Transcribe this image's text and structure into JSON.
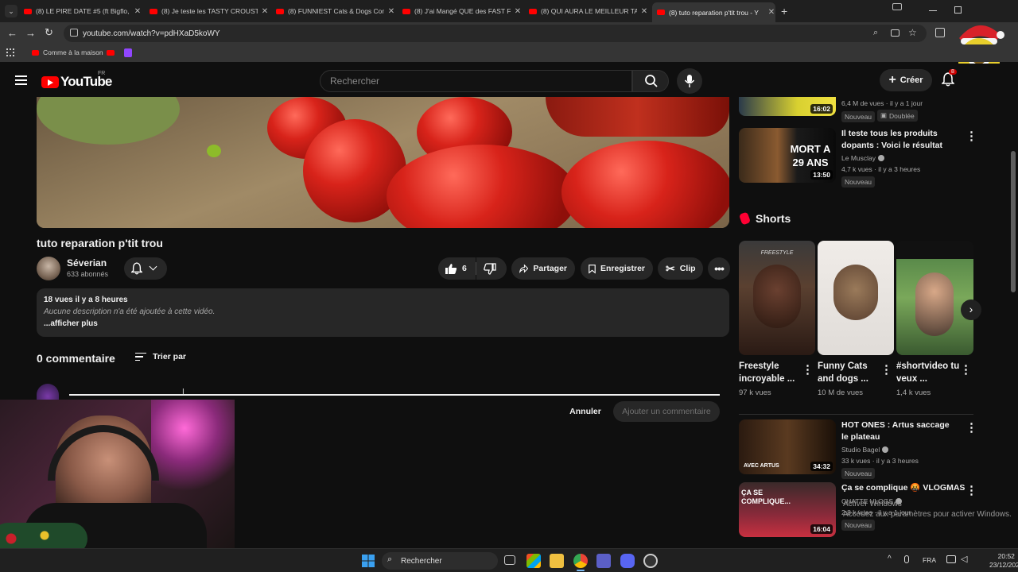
{
  "browser": {
    "tabs": [
      {
        "title": "(8) LE PIRE DATE #5 (ft Bigflo, Ar"
      },
      {
        "title": "(8) Je teste les TASTY CROUSTY"
      },
      {
        "title": "(8) FUNNIEST Cats & Dogs Com"
      },
      {
        "title": "(8) J'ai Mangé QUE des FAST FO"
      },
      {
        "title": "(8) QUI AURA LE MEILLEUR TAL"
      },
      {
        "title": "(8) tuto reparation p'tit trou - Y"
      }
    ],
    "url": "youtube.com/watch?v=pdHXaD5koWY",
    "bookmark_label": "Comme à la maison"
  },
  "header": {
    "logo_text": "YouTube",
    "country": "FR",
    "search_placeholder": "Rechercher",
    "create_label": "Créer",
    "notif_count": "8"
  },
  "video": {
    "title": "tuto reparation p'tit trou",
    "channel": "Séverian",
    "subscribers": "633 abonnés",
    "likes": "6",
    "share_label": "Partager",
    "save_label": "Enregistrer",
    "clip_label": "Clip",
    "views_time": "18 vues  il y a 8 heures",
    "description_empty": "Aucune description n'a été ajoutée à cette vidéo.",
    "show_more": "...afficher plus"
  },
  "comments": {
    "count_label": "0 commentaire",
    "sort_label": "Trier par",
    "cancel_label": "Annuler",
    "add_label": "Ajouter un commentaire"
  },
  "sidebar": {
    "top_partial": {
      "duration": "16:02",
      "meta": "6,4 M de vues · il y a 1 jour",
      "badge_new": "Nouveau",
      "badge_dub": "Doublée"
    },
    "videos": [
      {
        "title": "Il teste tous les produits dopants : Voici le résultat",
        "channel": "Le Musclay",
        "meta": "4,7 k vues · il y a 3 heures",
        "badge": "Nouveau",
        "duration": "13:50",
        "thumb_text": "MORT A 29 ANS"
      },
      {
        "title": "HOT ONES : Artus saccage le plateau",
        "channel": "Studio Bagel",
        "meta": "33 k vues · il y a 3 heures",
        "badge": "Nouveau",
        "duration": "34:32",
        "thumb_text": "AVEC ARTUS"
      },
      {
        "title": "Ça se complique 🤬 VLOGMAS",
        "channel": "CHATTE VLOGS",
        "meta": "2,8 k vues · il y a 1 jour",
        "badge": "Nouveau",
        "duration": "16:04",
        "thumb_text": "ÇA SE COMPLIQUE..."
      }
    ],
    "shorts_label": "Shorts",
    "shorts": [
      {
        "title": "Freestyle incroyable ...",
        "views": "97 k vues",
        "thumb_text": "FREESTYLE"
      },
      {
        "title": "Funny Cats and dogs ...",
        "views": "10 M de vues"
      },
      {
        "title": "#shortvideo tu veux ...",
        "views": "1,4 k vues"
      }
    ]
  },
  "taskbar": {
    "search_label": "Rechercher",
    "lang": "FRA",
    "time": "20:52",
    "date": "23/12/2025"
  },
  "watermark": {
    "line1": "Activer Windows",
    "line2": "Accédez aux paramètres pour activer Windows."
  },
  "colors": {
    "background": "#0f0f0f",
    "surface": "#272727",
    "brand_red": "#ff0000",
    "text": "#f1f1f1",
    "muted": "#aaaaaa"
  }
}
